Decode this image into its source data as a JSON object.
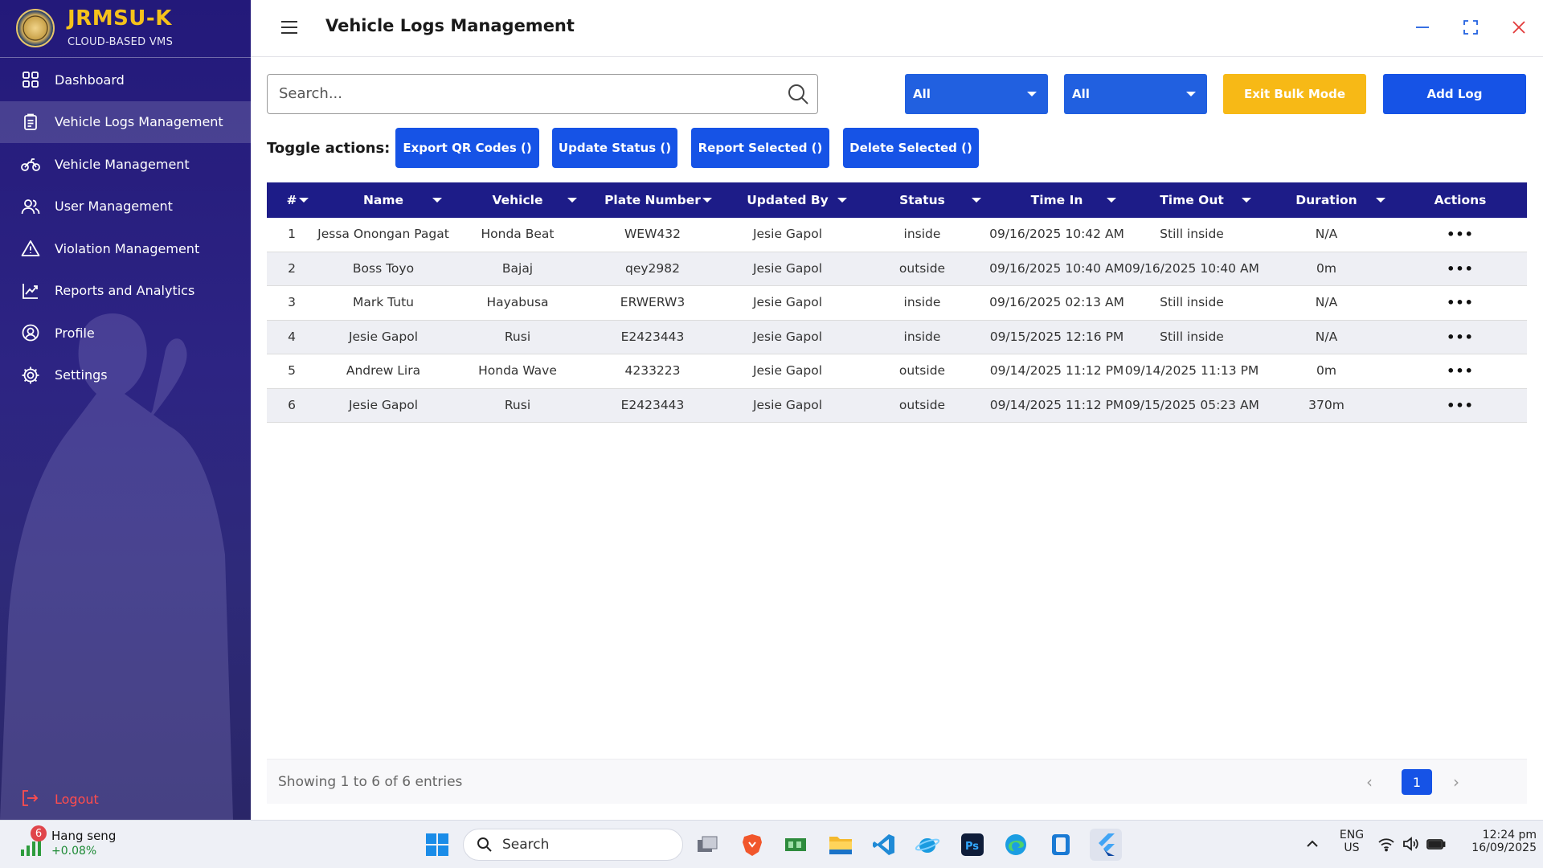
{
  "brand": {
    "title": "JRMSU-K",
    "subtitle": "CLOUD-BASED VMS"
  },
  "sidebar": {
    "items": [
      {
        "label": "Dashboard",
        "icon": "dashboard-icon"
      },
      {
        "label": "Vehicle Logs Management",
        "icon": "clipboard-icon",
        "active": true
      },
      {
        "label": "Vehicle Management",
        "icon": "motorcycle-icon"
      },
      {
        "label": "User Management",
        "icon": "users-icon"
      },
      {
        "label": "Violation Management",
        "icon": "warning-icon"
      },
      {
        "label": "Reports and Analytics",
        "icon": "chart-icon"
      },
      {
        "label": "Profile",
        "icon": "profile-icon"
      },
      {
        "label": "Settings",
        "icon": "gear-icon"
      }
    ],
    "logout": "Logout"
  },
  "header": {
    "title": "Vehicle Logs Management"
  },
  "toolbar": {
    "search_placeholder": "Search...",
    "filter1": "All",
    "filter2": "All",
    "exit_bulk": "Exit Bulk Mode",
    "add_log": "Add Log"
  },
  "toggle": {
    "label": "Toggle actions:",
    "export": "Export QR Codes ()",
    "update": "Update Status ()",
    "report": "Report Selected ()",
    "delete": "Delete Selected ()"
  },
  "table": {
    "columns": [
      "#",
      "Name",
      "Vehicle",
      "Plate Number",
      "Updated By",
      "Status",
      "Time In",
      "Time Out",
      "Duration",
      "Actions"
    ],
    "rows": [
      [
        "1",
        "Jessa Onongan Pagat",
        "Honda Beat",
        "WEW432",
        "Jesie Gapol",
        "inside",
        "09/16/2025 10:42 AM",
        "Still inside",
        "N/A"
      ],
      [
        "2",
        "Boss Toyo",
        "Bajaj",
        "qey2982",
        "Jesie Gapol",
        "outside",
        "09/16/2025 10:40 AM",
        "09/16/2025 10:40 AM",
        "0m"
      ],
      [
        "3",
        "Mark Tutu",
        "Hayabusa",
        "ERWERW3",
        "Jesie Gapol",
        "inside",
        "09/16/2025 02:13 AM",
        "Still inside",
        "N/A"
      ],
      [
        "4",
        "Jesie Gapol",
        "Rusi",
        "E2423443",
        "Jesie Gapol",
        "inside",
        "09/15/2025 12:16 PM",
        "Still inside",
        "N/A"
      ],
      [
        "5",
        "Andrew Lira",
        "Honda Wave",
        "4233223",
        "Jesie Gapol",
        "outside",
        "09/14/2025 11:12 PM",
        "09/14/2025 11:13 PM",
        "0m"
      ],
      [
        "6",
        "Jesie Gapol",
        "Rusi",
        "E2423443",
        "Jesie Gapol",
        "outside",
        "09/14/2025 11:12 PM",
        "09/15/2025 05:23 AM",
        "370m"
      ]
    ],
    "actions_label": "•••"
  },
  "footer": {
    "info": "Showing 1 to 6 of 6 entries",
    "page": "1"
  },
  "taskbar": {
    "widget_badge": "6",
    "widget_name": "Hang seng",
    "widget_change": "+0.08%",
    "search": "Search",
    "lang1": "ENG",
    "lang2": "US",
    "time": "12:24 pm",
    "date": "16/09/2025"
  },
  "colors": {
    "sidebar": "#23197a",
    "accent": "#1653e6",
    "header_row": "#1d1c88",
    "warning": "#f7b916",
    "brand_text": "#f5c21b",
    "logout": "#ff4d4d"
  }
}
